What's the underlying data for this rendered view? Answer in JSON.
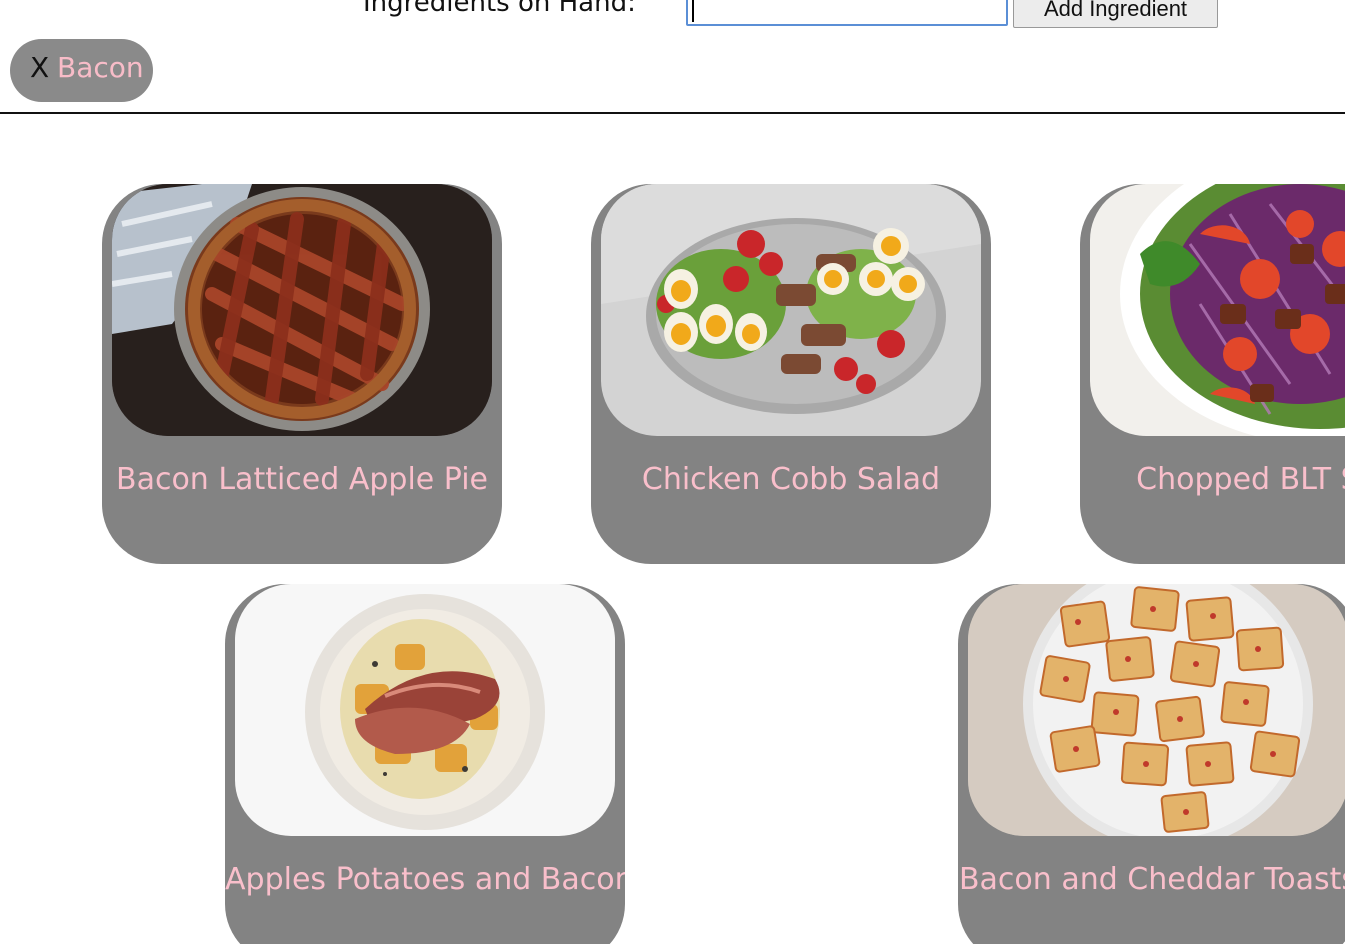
{
  "header": {
    "ingredient_label": "Ingredients on Hand:",
    "ingredient_input_value": "",
    "add_button_label": "Add Ingredient"
  },
  "tags": [
    {
      "remove_label": "X",
      "label": "Bacon"
    }
  ],
  "colors": {
    "card_background": "#838383",
    "title_text": "#f9bfcb",
    "input_focus_border": "#5b8fd6"
  },
  "recipes": [
    {
      "title": "Bacon Latticed Apple Pie",
      "image": "bacon-lattice-apple-pie-photo"
    },
    {
      "title": "Chicken Cobb Salad",
      "image": "chicken-cobb-salad-photo"
    },
    {
      "title": "Chopped BLT Salad",
      "image": "chopped-blt-salad-photo"
    },
    {
      "title": "Apples Potatoes and Bacon",
      "image": "apples-potatoes-bacon-photo"
    },
    {
      "title": "Bacon and Cheddar Toasts",
      "image": "bacon-cheddar-toasts-photo"
    }
  ]
}
